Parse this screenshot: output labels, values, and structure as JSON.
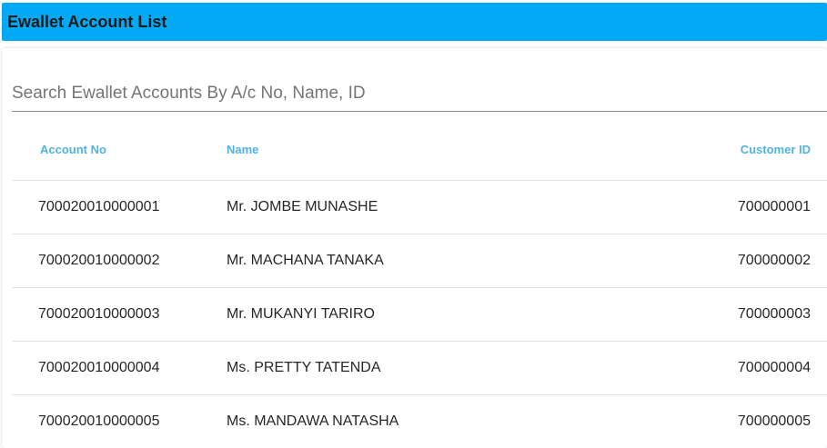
{
  "header": {
    "title": "Ewallet Account List",
    "color": "#03a9f4"
  },
  "search": {
    "placeholder": "Search Ewallet Accounts By A/c No, Name, ID",
    "value": ""
  },
  "table": {
    "columns": {
      "account_no": "Account No",
      "name": "Name",
      "customer_id": "Customer ID"
    },
    "header_color": "#4fb3e0",
    "rows": [
      {
        "account_no": "700020010000001",
        "name": "Mr. JOMBE MUNASHE",
        "customer_id": "700000001"
      },
      {
        "account_no": "700020010000002",
        "name": "Mr. MACHANA TANAKA",
        "customer_id": "700000002"
      },
      {
        "account_no": "700020010000003",
        "name": "Mr. MUKANYI TARIRO",
        "customer_id": "700000003"
      },
      {
        "account_no": "700020010000004",
        "name": "Ms. PRETTY TATENDA",
        "customer_id": "700000004"
      },
      {
        "account_no": "700020010000005",
        "name": "Ms. MANDAWA NATASHA",
        "customer_id": "700000005"
      }
    ]
  }
}
